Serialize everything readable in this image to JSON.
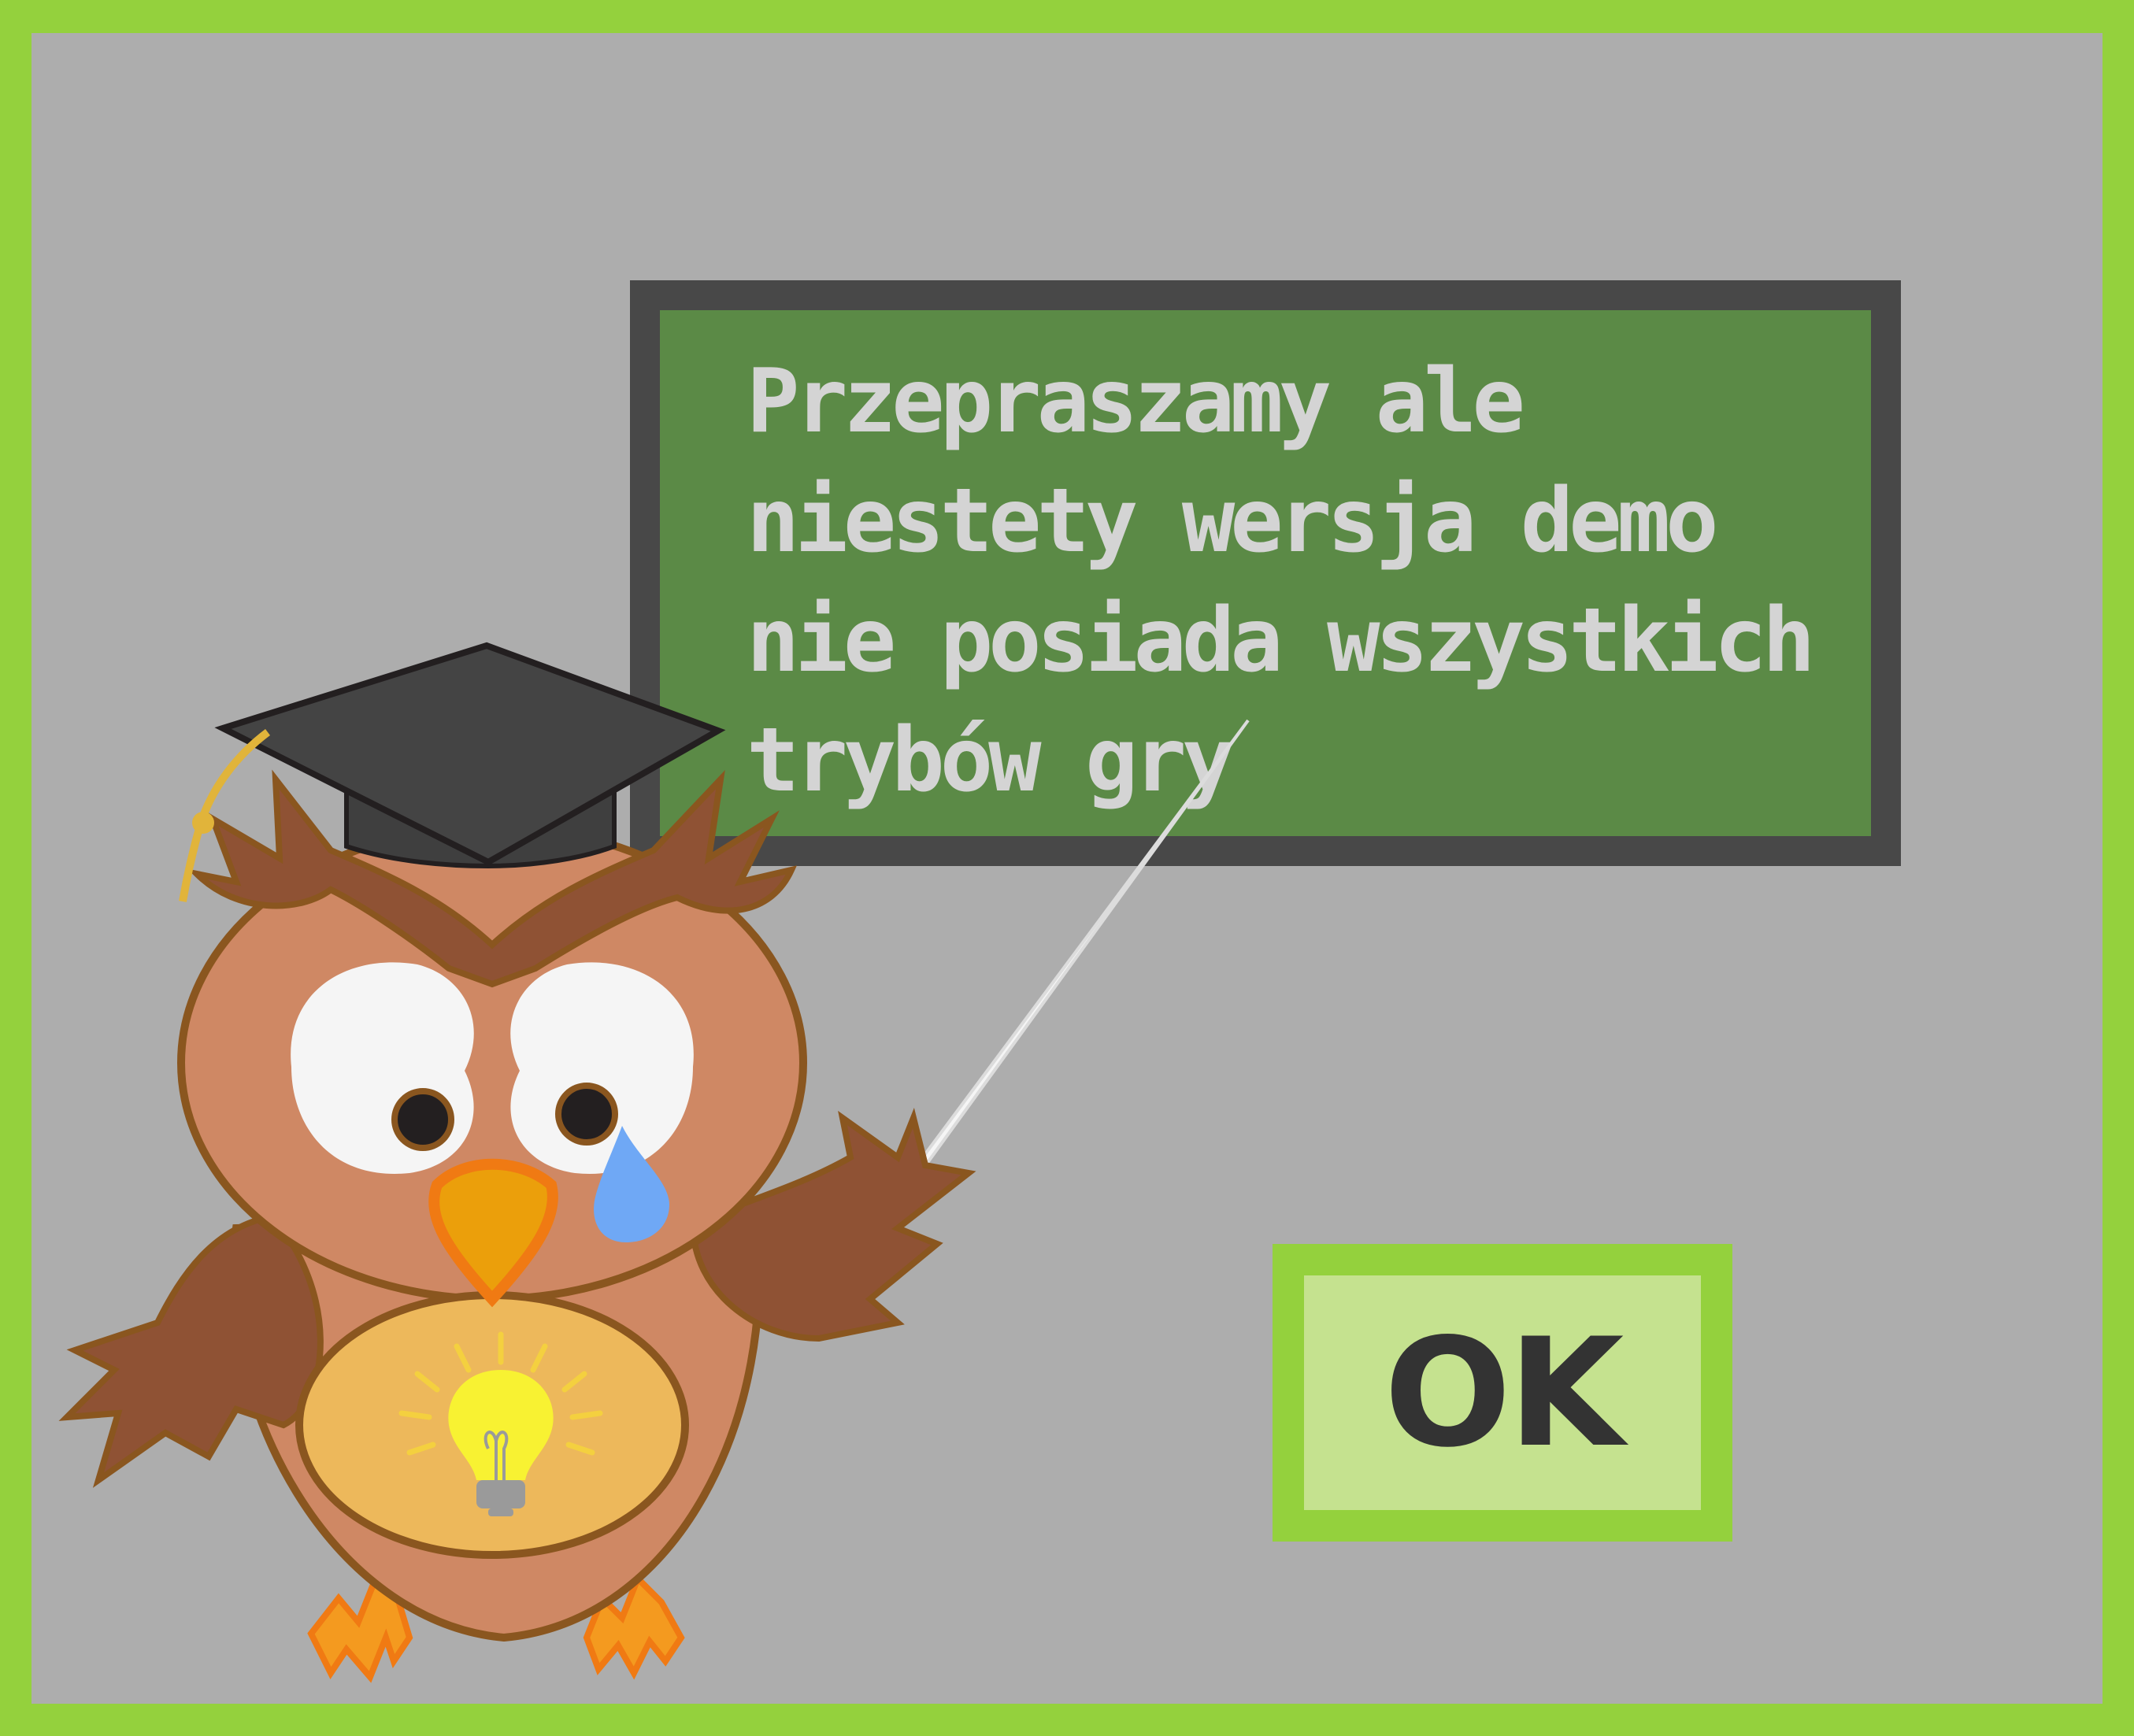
{
  "dialog": {
    "message": "Przepraszamy ale\nniestety wersja demo\nnie posiada wszystkich\ntrybów gry",
    "ok_label": "OK"
  },
  "colors": {
    "outer_frame": "#94d13d",
    "panel": "#adadad",
    "board_frame": "#484848",
    "board": "#5b8a46",
    "text": "#d4d4d4",
    "button_frame": "#94d13d",
    "button_fill": "#c5e28f",
    "button_text": "#333333"
  },
  "icons": [
    "owl-teacher-mascot",
    "graduation-cap-icon",
    "lightbulb-icon",
    "pointer-stick-icon",
    "tear-drop-icon"
  ]
}
